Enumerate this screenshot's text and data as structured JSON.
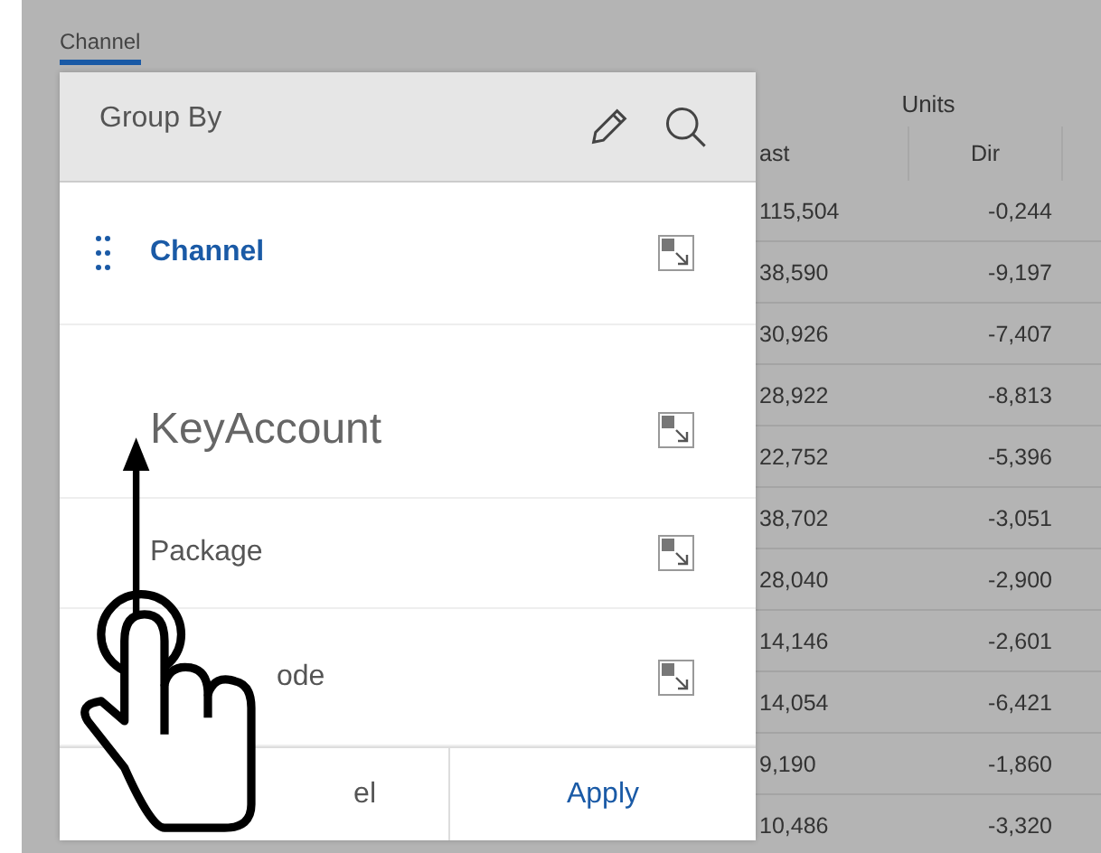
{
  "tab": {
    "label": "Channel",
    "selected": true
  },
  "group_by": {
    "title": "Group By",
    "items": [
      {
        "label": "Channel",
        "selected": true,
        "dragging": false
      },
      {
        "label": "KeyAccount",
        "selected": false,
        "dragging": true
      },
      {
        "label": "Package",
        "selected": false,
        "dragging": false
      },
      {
        "label": "ode",
        "selected": false,
        "dragging": false
      }
    ],
    "buttons": [
      {
        "label": "el",
        "kind": "cancel"
      },
      {
        "label": "Apply",
        "kind": "apply"
      }
    ]
  },
  "table": {
    "group_header": "Units",
    "columns": [
      "ast",
      "Dir"
    ],
    "rows": [
      [
        "115,504",
        "-0,244"
      ],
      [
        "38,590",
        "-9,197"
      ],
      [
        "30,926",
        "-7,407"
      ],
      [
        "28,922",
        "-8,813"
      ],
      [
        "22,752",
        "-5,396"
      ],
      [
        "38,702",
        "-3,051"
      ],
      [
        "28,040",
        "-2,900"
      ],
      [
        "14,146",
        "-2,601"
      ],
      [
        "14,054",
        "-6,421"
      ],
      [
        "9,190",
        "-1,860"
      ],
      [
        "10,486",
        "-3,320"
      ]
    ]
  }
}
